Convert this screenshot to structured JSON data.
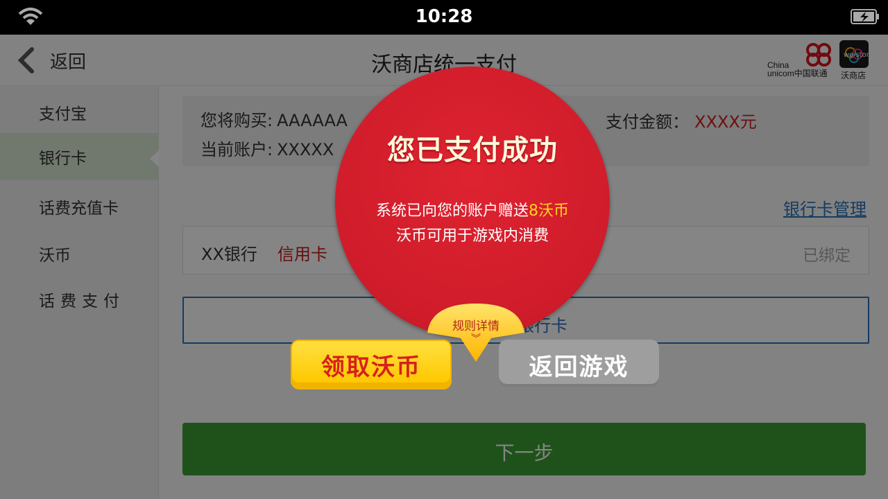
{
  "statusbar": {
    "time": "10:28"
  },
  "navbar": {
    "back_label": "返回",
    "title": "沃商店统一支付",
    "brand_cu_line1": "China",
    "brand_cu_line2": "unicom中国联通",
    "brand_wo_logo": "wo store",
    "brand_wo": "沃商店"
  },
  "sidebar": {
    "items": [
      {
        "label": "支付宝"
      },
      {
        "label": "银行卡"
      },
      {
        "label": "话费充值卡"
      },
      {
        "label": "沃币"
      },
      {
        "label": "话费支付"
      }
    ],
    "active_index": 1
  },
  "order": {
    "purchase_label": "您将购买:",
    "purchase_value": "AAAAAA",
    "account_label": "当前账户:",
    "account_value": "XXXXX",
    "amount_label": "支付金额：",
    "amount_value": "XXXX元"
  },
  "bank": {
    "manage_link": "银行卡管理",
    "card_name": "XX银行",
    "card_type": "信用卡",
    "card_status": "已绑定",
    "add_card_label": "添加银行卡"
  },
  "next_button": "下一步",
  "popup": {
    "title": "您已支付成功",
    "gift_prefix": "系统已向您的账户赠送",
    "gift_amount": "8沃币",
    "usage": "沃币可用于游戏内消费",
    "rules_label": "规则详情",
    "claim_button": "领取沃币",
    "return_button": "返回游戏"
  },
  "colors": {
    "accent_red": "#d02020",
    "popup_red": "#cf1c2b",
    "link_blue": "#2a72b8",
    "next_green": "#3d9d35",
    "claim_yellow": "#ffc800",
    "coin_yellow": "#ffd21f"
  },
  "icons": [
    "wifi-icon",
    "battery-icon",
    "back-chevron-icon",
    "chevron-down-icon"
  ]
}
